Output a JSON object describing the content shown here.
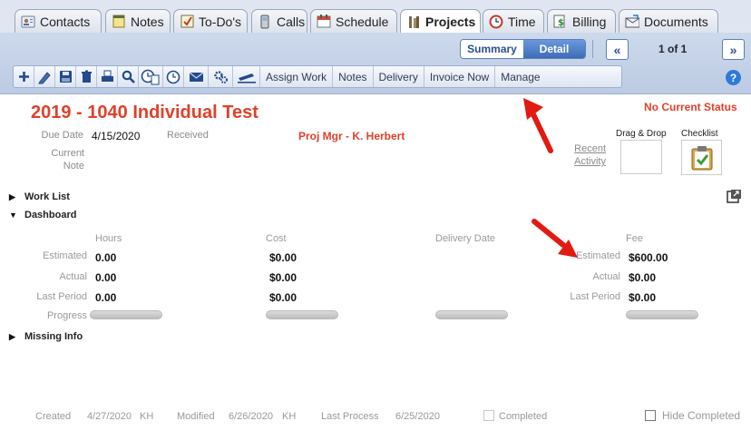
{
  "tabs": [
    {
      "label": "Contacts",
      "icon": "contacts-icon"
    },
    {
      "label": "Notes",
      "icon": "notes-icon"
    },
    {
      "label": "To-Do's",
      "icon": "todo-icon"
    },
    {
      "label": "Calls",
      "icon": "phone-icon"
    },
    {
      "label": "Schedule",
      "icon": "calendar-icon"
    },
    {
      "label": "Projects",
      "icon": "projects-icon",
      "active": true
    },
    {
      "label": "Time",
      "icon": "clock-icon"
    },
    {
      "label": "Billing",
      "icon": "billing-icon"
    },
    {
      "label": "Documents",
      "icon": "documents-icon"
    }
  ],
  "view_toggle": {
    "summary": "Summary",
    "detail": "Detail",
    "selected": "Detail"
  },
  "pager": {
    "prev": "«",
    "next": "»",
    "info": "1 of 1"
  },
  "toolbar": {
    "icons": [
      "add-icon",
      "edit-icon",
      "save-icon",
      "delete-icon",
      "print-icon",
      "search-icon",
      "clock-docs-icon",
      "clock-icon",
      "email-icon",
      "settings-icon",
      "pen-icon"
    ],
    "assign_work": "Assign Work",
    "notes": "Notes",
    "delivery": "Delivery",
    "invoice_now": "Invoice Now",
    "manage": "Manage"
  },
  "help": "?",
  "project": {
    "title": "2019 - 1040 Individual Test",
    "status": "No Current Status",
    "due_date_label": "Due Date",
    "due_date": "4/15/2020",
    "received_label": "Received",
    "proj_mgr": "Proj Mgr - K. Herbert",
    "current_note_label_1": "Current",
    "current_note_label_2": "Note",
    "recent_activity_1": "Recent",
    "recent_activity_2": "Activity",
    "drag_drop_label": "Drag & Drop",
    "checklist_label": "Checklist"
  },
  "sections": {
    "work_list": "Work List",
    "dashboard": "Dashboard",
    "missing_info": "Missing Info"
  },
  "dashboard": {
    "columns": {
      "hours": "Hours",
      "cost": "Cost",
      "delivery_date": "Delivery Date",
      "fee": "Fee"
    },
    "rows": {
      "estimated": "Estimated",
      "actual": "Actual",
      "last_period": "Last Period",
      "progress": "Progress"
    },
    "hours": {
      "estimated": "0.00",
      "actual": "0.00",
      "last_period": "0.00",
      "progress": 0
    },
    "cost": {
      "estimated": "$0.00",
      "actual": "$0.00",
      "last_period": "$0.00",
      "progress": 0
    },
    "delivery": {
      "progress": 0
    },
    "fee_labels": {
      "estimated": "Estimated",
      "actual": "Actual",
      "last_period": "Last Period"
    },
    "fee": {
      "estimated": "$600.00",
      "actual": "$0.00",
      "last_period": "$0.00",
      "progress": 0
    }
  },
  "footer": {
    "created_label": "Created",
    "created_value": "4/27/2020",
    "created_by": "KH",
    "modified_label": "Modified",
    "modified_value": "6/26/2020",
    "modified_by": "KH",
    "last_process_label": "Last Process",
    "last_process_value": "6/25/2020",
    "completed_label": "Completed",
    "hide_completed_label": "Hide Completed"
  },
  "colors": {
    "accent_red": "#e1402a",
    "toolbar_blue": "#3d6cb8"
  }
}
